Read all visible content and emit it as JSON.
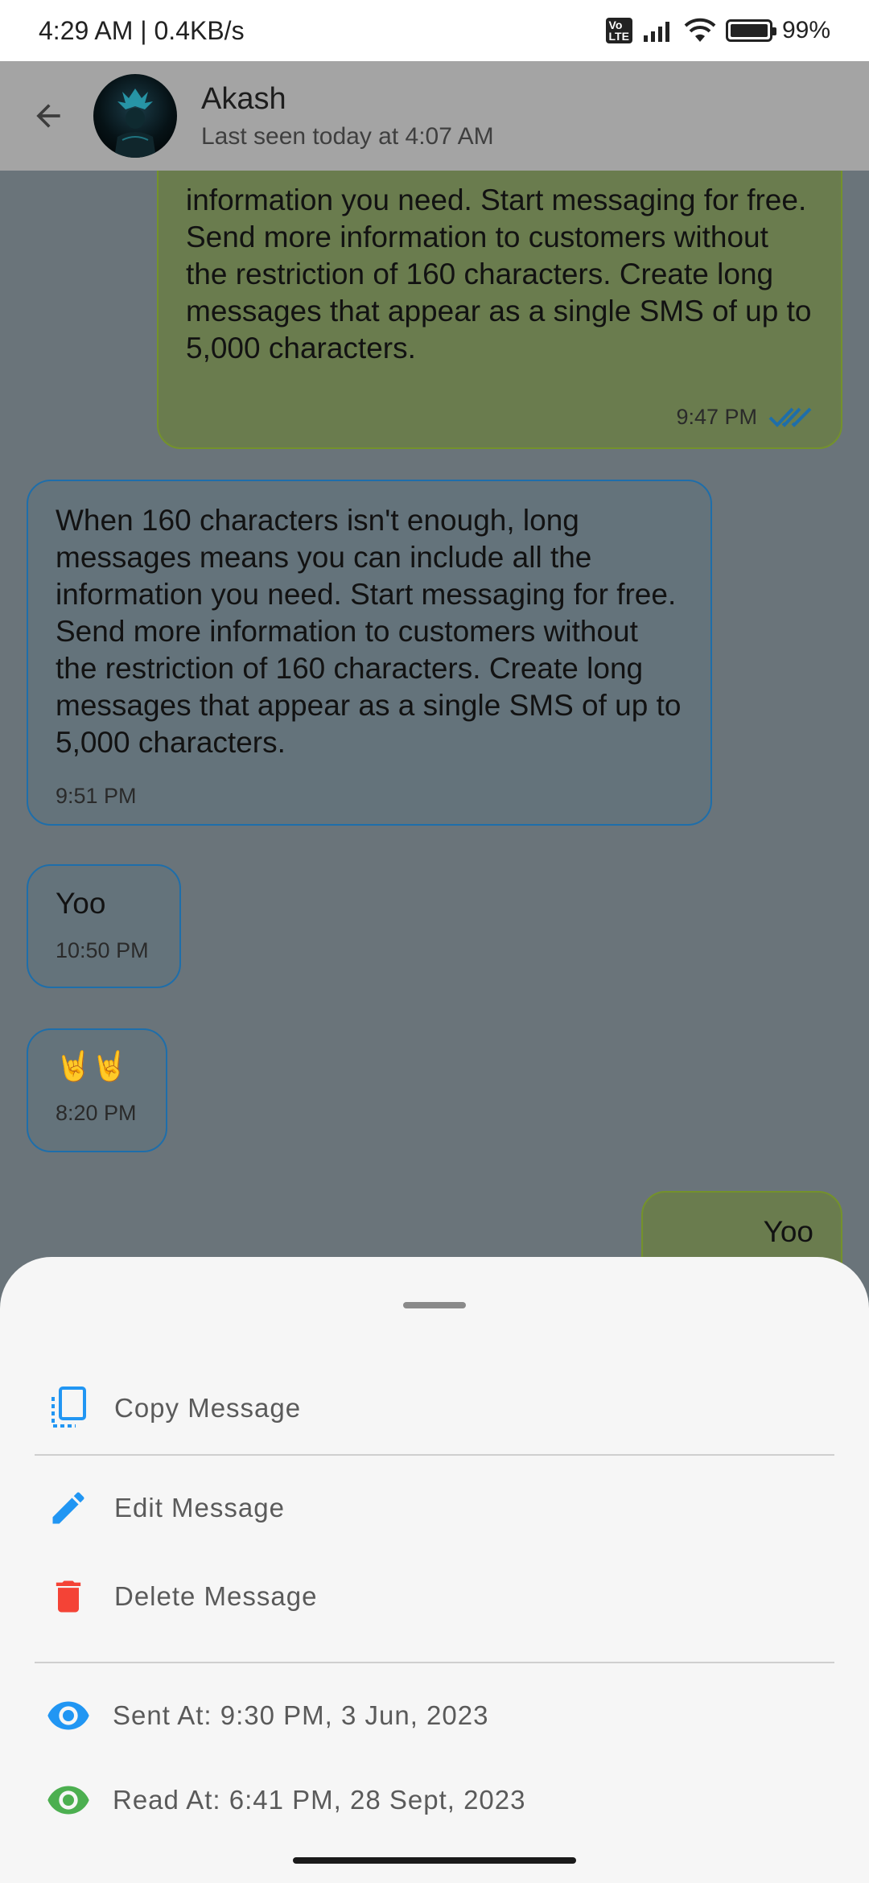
{
  "status_bar": {
    "time_speed": "4:29 AM | 0.4KB/s",
    "volte": "Vo LTE",
    "battery": "99%"
  },
  "header": {
    "name": "Akash",
    "status": "Last seen today at 4:07 AM"
  },
  "messages": [
    {
      "direction": "out",
      "text": "information you need. Start messaging for free. Send more information to customers without the restriction of 160 characters. Create long messages that appear as a single SMS of up to 5,000 characters.",
      "time": "9:47 PM",
      "read": true
    },
    {
      "direction": "in",
      "text": "When 160 characters isn't enough, long messages means you can include all the information you need. Start messaging for free. Send more information to customers without the restriction of 160 characters. Create long messages that appear as a single SMS of up to 5,000 characters.",
      "time": "9:51 PM"
    },
    {
      "direction": "in",
      "text": "Yoo",
      "time": "10:50 PM"
    },
    {
      "direction": "in",
      "text": "🤘🤘",
      "time": "8:20 PM"
    },
    {
      "direction": "out",
      "text": "Yoo",
      "time": ""
    }
  ],
  "sheet": {
    "copy_label": "Copy Message",
    "edit_label": "Edit Message",
    "delete_label": "Delete Message",
    "sent_at": "Sent At: 9:30 PM, 3 Jun, 2023",
    "read_at": "Read At: 6:41 PM, 28 Sept, 2023"
  },
  "colors": {
    "accent_blue": "#2196f3",
    "delete_red": "#f44336",
    "read_green": "#4caf50"
  }
}
